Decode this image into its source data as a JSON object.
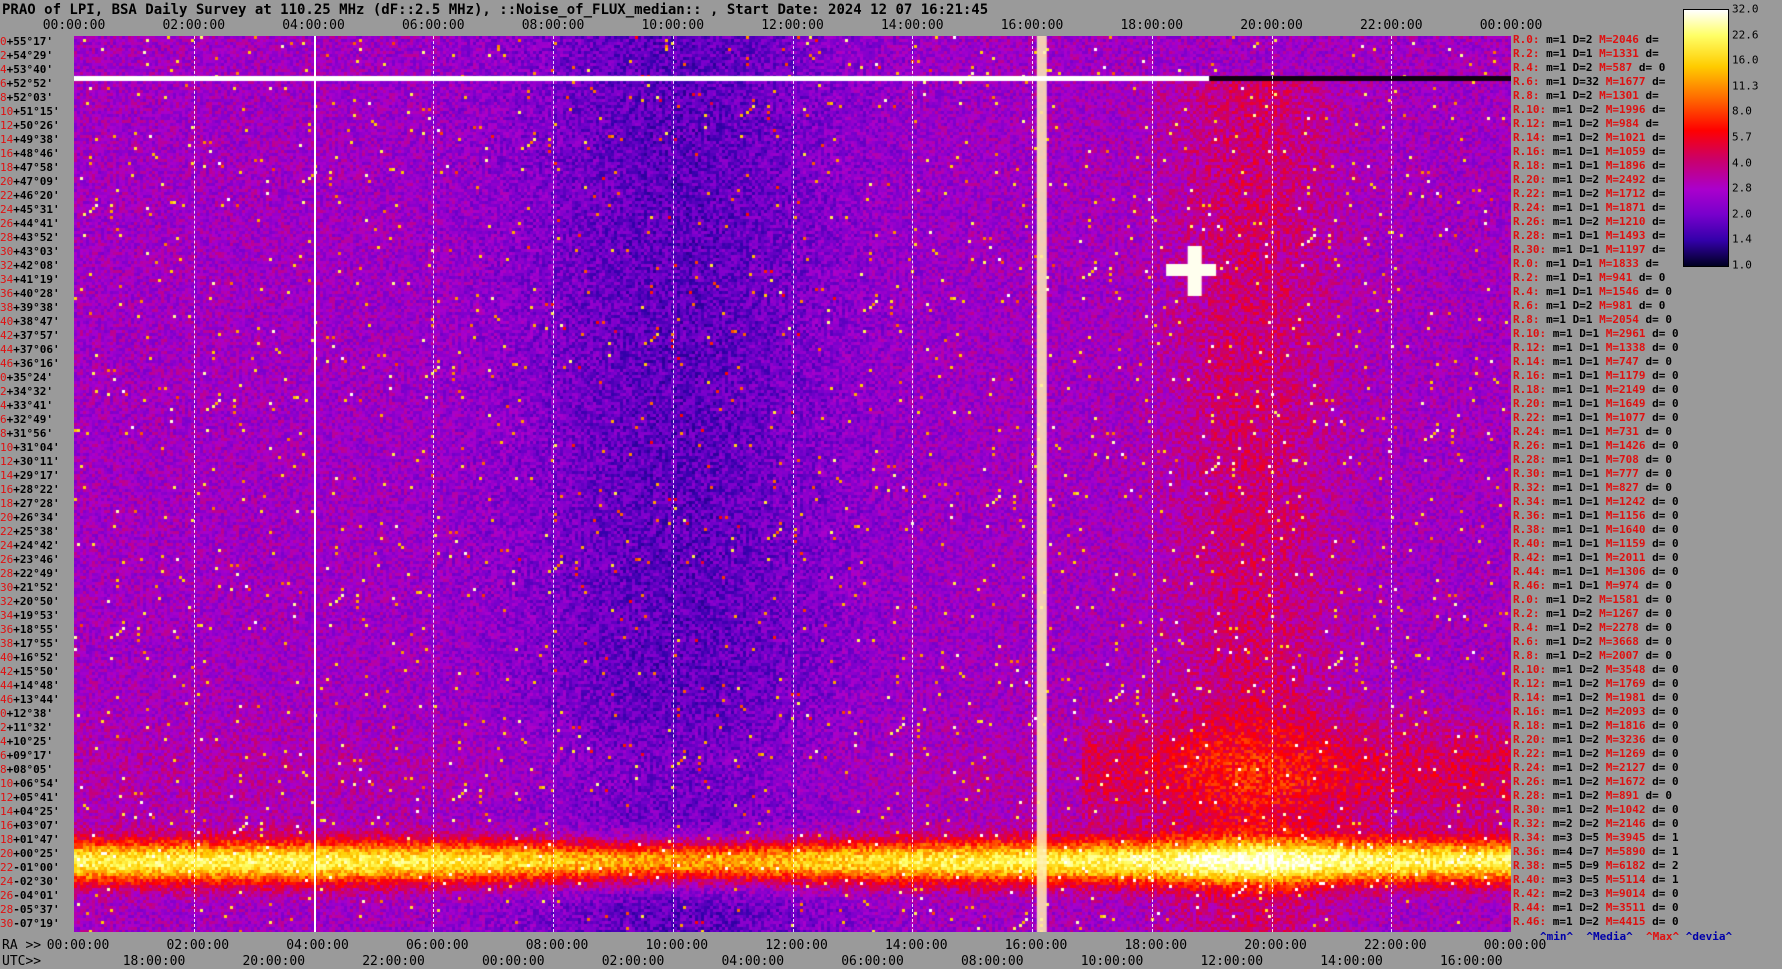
{
  "title": "PRAO of LPI, BSA Daily Survey at 110.25 MHz (dF::2.5 MHz), ::Noise_of_FLUX_median:: , Start Date: 2024 12 07 16:21:45",
  "top_axis": [
    "00:00:00",
    "02:00:00",
    "04:00:00",
    "06:00:00",
    "08:00:00",
    "10:00:00",
    "12:00:00",
    "14:00:00",
    "16:00:00",
    "18:00:00",
    "20:00:00",
    "22:00:00",
    "00:00:00"
  ],
  "bottom_axis": {
    "ra_label": "RA >>",
    "utc_label": "UTC>>",
    "ra_ticks": [
      "00:00:00",
      "02:00:00",
      "04:00:00",
      "06:00:00",
      "08:00:00",
      "10:00:00",
      "12:00:00",
      "14:00:00",
      "16:00:00",
      "18:00:00",
      "20:00:00",
      "22:00:00",
      "00:00:00"
    ],
    "utc_ticks": [
      "18:00:00",
      "20:00:00",
      "22:00:00",
      "00:00:00",
      "02:00:00",
      "04:00:00",
      "06:00:00",
      "08:00:00",
      "10:00:00",
      "12:00:00",
      "14:00:00",
      "16:00:00"
    ]
  },
  "dec_labels": [
    {
      "idx": "0",
      "val": "+55°17'"
    },
    {
      "idx": "2",
      "val": "+54°29'"
    },
    {
      "idx": "4",
      "val": "+53°40'"
    },
    {
      "idx": "6",
      "val": "+52°52'"
    },
    {
      "idx": "8",
      "val": "+52°03'"
    },
    {
      "idx": "10",
      "val": "+51°15'"
    },
    {
      "idx": "12",
      "val": "+50°26'"
    },
    {
      "idx": "14",
      "val": "+49°38'"
    },
    {
      "idx": "16",
      "val": "+48°46'"
    },
    {
      "idx": "18",
      "val": "+47°58'"
    },
    {
      "idx": "20",
      "val": "+47°09'"
    },
    {
      "idx": "22",
      "val": "+46°20'"
    },
    {
      "idx": "24",
      "val": "+45°31'"
    },
    {
      "idx": "26",
      "val": "+44°41'"
    },
    {
      "idx": "28",
      "val": "+43°52'"
    },
    {
      "idx": "30",
      "val": "+43°03'"
    },
    {
      "idx": "32",
      "val": "+42°08'"
    },
    {
      "idx": "34",
      "val": "+41°19'"
    },
    {
      "idx": "36",
      "val": "+40°28'"
    },
    {
      "idx": "38",
      "val": "+39°38'"
    },
    {
      "idx": "40",
      "val": "+38°47'"
    },
    {
      "idx": "42",
      "val": "+37°57'"
    },
    {
      "idx": "44",
      "val": "+37°06'"
    },
    {
      "idx": "46",
      "val": "+36°16'"
    },
    {
      "idx": "0",
      "val": "+35°24'"
    },
    {
      "idx": "2",
      "val": "+34°32'"
    },
    {
      "idx": "4",
      "val": "+33°41'"
    },
    {
      "idx": "6",
      "val": "+32°49'"
    },
    {
      "idx": "8",
      "val": "+31°56'"
    },
    {
      "idx": "10",
      "val": "+31°04'"
    },
    {
      "idx": "12",
      "val": "+30°11'"
    },
    {
      "idx": "14",
      "val": "+29°17'"
    },
    {
      "idx": "16",
      "val": "+28°22'"
    },
    {
      "idx": "18",
      "val": "+27°28'"
    },
    {
      "idx": "20",
      "val": "+26°34'"
    },
    {
      "idx": "22",
      "val": "+25°38'"
    },
    {
      "idx": "24",
      "val": "+24°42'"
    },
    {
      "idx": "26",
      "val": "+23°46'"
    },
    {
      "idx": "28",
      "val": "+22°49'"
    },
    {
      "idx": "30",
      "val": "+21°52'"
    },
    {
      "idx": "32",
      "val": "+20°50'"
    },
    {
      "idx": "34",
      "val": "+19°53'"
    },
    {
      "idx": "36",
      "val": "+18°55'"
    },
    {
      "idx": "38",
      "val": "+17°55'"
    },
    {
      "idx": "40",
      "val": "+16°52'"
    },
    {
      "idx": "42",
      "val": "+15°50'"
    },
    {
      "idx": "44",
      "val": "+14°48'"
    },
    {
      "idx": "46",
      "val": "+13°44'"
    },
    {
      "idx": "0",
      "val": "+12°38'"
    },
    {
      "idx": "2",
      "val": "+11°32'"
    },
    {
      "idx": "4",
      "val": "+10°25'"
    },
    {
      "idx": "6",
      "val": "+09°17'"
    },
    {
      "idx": "8",
      "val": "+08°05'"
    },
    {
      "idx": "10",
      "val": "+06°54'"
    },
    {
      "idx": "12",
      "val": "+05°41'"
    },
    {
      "idx": "14",
      "val": "+04°25'"
    },
    {
      "idx": "16",
      "val": "+03°07'"
    },
    {
      "idx": "18",
      "val": "+01°47'"
    },
    {
      "idx": "20",
      "val": "+00°25'"
    },
    {
      "idx": "22",
      "val": "-01°00'"
    },
    {
      "idx": "24",
      "val": "-02°30'"
    },
    {
      "idx": "26",
      "val": "-04°01'"
    },
    {
      "idx": "28",
      "val": "-05°37'"
    },
    {
      "idx": "30",
      "val": "-07°19'"
    }
  ],
  "right_stats": [
    {
      "r": "R.0:",
      "m": "m=1 D=2",
      "mx": "M=2046",
      "d": "d="
    },
    {
      "r": "R.2:",
      "m": "m=1 D=1",
      "mx": "M=1331",
      "d": "d="
    },
    {
      "r": "R.4:",
      "m": "m=1 D=2",
      "mx": "M=587",
      "d": "d= 0"
    },
    {
      "r": "R.6:",
      "m": "m=1 D=32",
      "mx": "M=1677",
      "d": "d="
    },
    {
      "r": "R.8:",
      "m": "m=1 D=2",
      "mx": "M=1301",
      "d": "d="
    },
    {
      "r": "R.10:",
      "m": "m=1 D=2",
      "mx": "M=1996",
      "d": "d="
    },
    {
      "r": "R.12:",
      "m": "m=1 D=2",
      "mx": "M=984",
      "d": "d="
    },
    {
      "r": "R.14:",
      "m": "m=1 D=2",
      "mx": "M=1021",
      "d": "d="
    },
    {
      "r": "R.16:",
      "m": "m=1 D=1",
      "mx": "M=1059",
      "d": "d="
    },
    {
      "r": "R.18:",
      "m": "m=1 D=1",
      "mx": "M=1896",
      "d": "d="
    },
    {
      "r": "R.20:",
      "m": "m=1 D=2",
      "mx": "M=2492",
      "d": "d="
    },
    {
      "r": "R.22:",
      "m": "m=1 D=2",
      "mx": "M=1712",
      "d": "d="
    },
    {
      "r": "R.24:",
      "m": "m=1 D=1",
      "mx": "M=1871",
      "d": "d="
    },
    {
      "r": "R.26:",
      "m": "m=1 D=2",
      "mx": "M=1210",
      "d": "d="
    },
    {
      "r": "R.28:",
      "m": "m=1 D=1",
      "mx": "M=1493",
      "d": "d="
    },
    {
      "r": "R.30:",
      "m": "m=1 D=1",
      "mx": "M=1197",
      "d": "d="
    },
    {
      "r": "R.0:",
      "m": "m=1 D=1",
      "mx": "M=1833",
      "d": "d="
    },
    {
      "r": "R.2:",
      "m": "m=1 D=1",
      "mx": "M=941",
      "d": "d= 0"
    },
    {
      "r": "R.4:",
      "m": "m=1 D=1",
      "mx": "M=1546",
      "d": "d= 0"
    },
    {
      "r": "R.6:",
      "m": "m=1 D=2",
      "mx": "M=981",
      "d": "d= 0"
    },
    {
      "r": "R.8:",
      "m": "m=1 D=1",
      "mx": "M=2054",
      "d": "d= 0"
    },
    {
      "r": "R.10:",
      "m": "m=1 D=1",
      "mx": "M=2961",
      "d": "d= 0"
    },
    {
      "r": "R.12:",
      "m": "m=1 D=1",
      "mx": "M=1338",
      "d": "d= 0"
    },
    {
      "r": "R.14:",
      "m": "m=1 D=1",
      "mx": "M=747",
      "d": "d= 0"
    },
    {
      "r": "R.16:",
      "m": "m=1 D=1",
      "mx": "M=1179",
      "d": "d= 0"
    },
    {
      "r": "R.18:",
      "m": "m=1 D=1",
      "mx": "M=2149",
      "d": "d= 0"
    },
    {
      "r": "R.20:",
      "m": "m=1 D=1",
      "mx": "M=1649",
      "d": "d= 0"
    },
    {
      "r": "R.22:",
      "m": "m=1 D=1",
      "mx": "M=1077",
      "d": "d= 0"
    },
    {
      "r": "R.24:",
      "m": "m=1 D=1",
      "mx": "M=731",
      "d": "d= 0"
    },
    {
      "r": "R.26:",
      "m": "m=1 D=1",
      "mx": "M=1426",
      "d": "d= 0"
    },
    {
      "r": "R.28:",
      "m": "m=1 D=1",
      "mx": "M=708",
      "d": "d= 0"
    },
    {
      "r": "R.30:",
      "m": "m=1 D=1",
      "mx": "M=777",
      "d": "d= 0"
    },
    {
      "r": "R.32:",
      "m": "m=1 D=1",
      "mx": "M=827",
      "d": "d= 0"
    },
    {
      "r": "R.34:",
      "m": "m=1 D=1",
      "mx": "M=1242",
      "d": "d= 0"
    },
    {
      "r": "R.36:",
      "m": "m=1 D=1",
      "mx": "M=1156",
      "d": "d= 0"
    },
    {
      "r": "R.38:",
      "m": "m=1 D=1",
      "mx": "M=1640",
      "d": "d= 0"
    },
    {
      "r": "R.40:",
      "m": "m=1 D=1",
      "mx": "M=1159",
      "d": "d= 0"
    },
    {
      "r": "R.42:",
      "m": "m=1 D=1",
      "mx": "M=2011",
      "d": "d= 0"
    },
    {
      "r": "R.44:",
      "m": "m=1 D=1",
      "mx": "M=1306",
      "d": "d= 0"
    },
    {
      "r": "R.46:",
      "m": "m=1 D=1",
      "mx": "M=974",
      "d": "d= 0"
    },
    {
      "r": "R.0:",
      "m": "m=1 D=2",
      "mx": "M=1581",
      "d": "d= 0"
    },
    {
      "r": "R.2:",
      "m": "m=1 D=2",
      "mx": "M=1267",
      "d": "d= 0"
    },
    {
      "r": "R.4:",
      "m": "m=1 D=2",
      "mx": "M=2278",
      "d": "d= 0"
    },
    {
      "r": "R.6:",
      "m": "m=1 D=2",
      "mx": "M=3668",
      "d": "d= 0"
    },
    {
      "r": "R.8:",
      "m": "m=1 D=2",
      "mx": "M=2007",
      "d": "d= 0"
    },
    {
      "r": "R.10:",
      "m": "m=1 D=2",
      "mx": "M=3548",
      "d": "d= 0"
    },
    {
      "r": "R.12:",
      "m": "m=1 D=2",
      "mx": "M=1769",
      "d": "d= 0"
    },
    {
      "r": "R.14:",
      "m": "m=1 D=2",
      "mx": "M=1981",
      "d": "d= 0"
    },
    {
      "r": "R.16:",
      "m": "m=1 D=2",
      "mx": "M=2093",
      "d": "d= 0"
    },
    {
      "r": "R.18:",
      "m": "m=1 D=2",
      "mx": "M=1816",
      "d": "d= 0"
    },
    {
      "r": "R.20:",
      "m": "m=1 D=2",
      "mx": "M=3236",
      "d": "d= 0"
    },
    {
      "r": "R.22:",
      "m": "m=1 D=2",
      "mx": "M=1269",
      "d": "d= 0"
    },
    {
      "r": "R.24:",
      "m": "m=1 D=2",
      "mx": "M=2127",
      "d": "d= 0"
    },
    {
      "r": "R.26:",
      "m": "m=1 D=2",
      "mx": "M=1672",
      "d": "d= 0"
    },
    {
      "r": "R.28:",
      "m": "m=1 D=2",
      "mx": "M=891",
      "d": "d= 0"
    },
    {
      "r": "R.30:",
      "m": "m=1 D=2",
      "mx": "M=1042",
      "d": "d= 0"
    },
    {
      "r": "R.32:",
      "m": "m=2 D=2",
      "mx": "M=2146",
      "d": "d= 0"
    },
    {
      "r": "R.34:",
      "m": "m=3 D=5",
      "mx": "M=3945",
      "d": "d= 1"
    },
    {
      "r": "R.36:",
      "m": "m=4 D=7",
      "mx": "M=5890",
      "d": "d= 1"
    },
    {
      "r": "R.38:",
      "m": "m=5 D=9",
      "mx": "M=6182",
      "d": "d= 2"
    },
    {
      "r": "R.40:",
      "m": "m=3 D=5",
      "mx": "M=5114",
      "d": "d= 1"
    },
    {
      "r": "R.42:",
      "m": "m=2 D=3",
      "mx": "M=9014",
      "d": "d= 0"
    },
    {
      "r": "R.44:",
      "m": "m=1 D=2",
      "mx": "M=3511",
      "d": "d= 0"
    },
    {
      "r": "R.46:",
      "m": "m=1 D=2",
      "mx": "M=4415",
      "d": "d= 0"
    }
  ],
  "legend": {
    "min": "^min^",
    "median": "^Media^",
    "max": "^Max^",
    "devia": "^devia^"
  },
  "chart_data": {
    "type": "heatmap",
    "title": "PRAO of LPI, BSA Daily Survey at 110.25 MHz (dF::2.5 MHz), ::Noise_of_FLUX_median:: , Start Date: 2024 12 07 16:21:45",
    "x_ra_range": [
      "00:00:00",
      "00:00:00"
    ],
    "colorbar": {
      "ticks": [
        "32.0",
        "22.6",
        "16.0",
        "11.3",
        "8.0",
        "5.7",
        "4.0",
        "2.8",
        "2.0",
        "1.4",
        "1.0"
      ],
      "scale": "log",
      "range": [
        1.0,
        32.0
      ],
      "colors": [
        "#ffffff",
        "#ffff66",
        "#ffcc00",
        "#ff6600",
        "#ff0000",
        "#cc0066",
        "#aa00cc",
        "#7700cc",
        "#3300aa",
        "#000022"
      ]
    }
  }
}
